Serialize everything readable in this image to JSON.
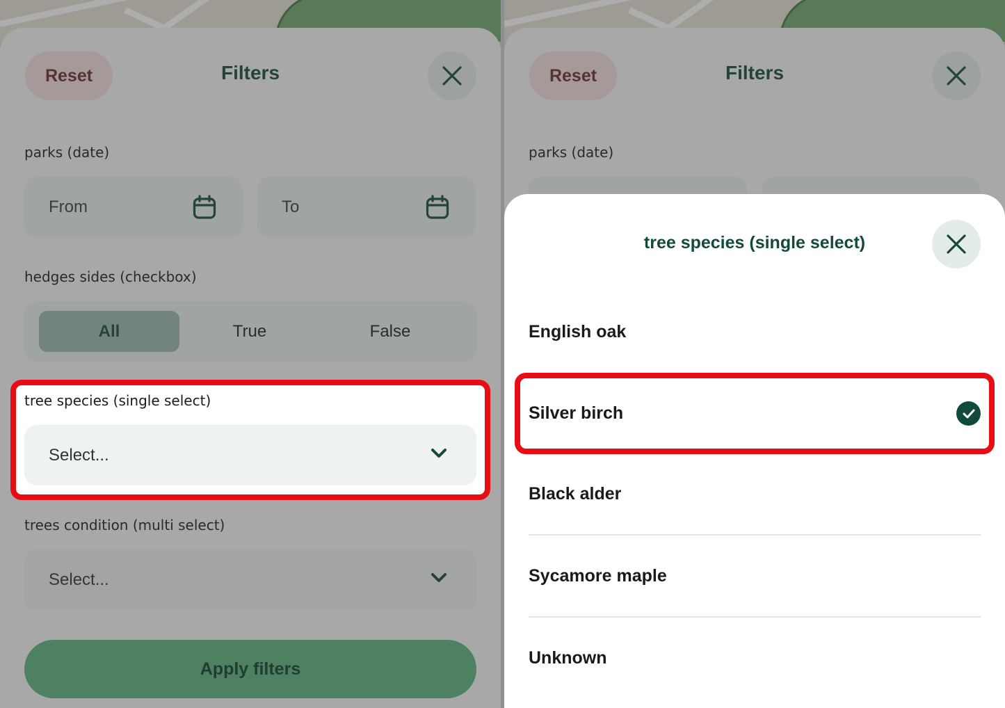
{
  "left": {
    "header": {
      "reset_label": "Reset",
      "title": "Filters"
    },
    "parks_date": {
      "label": "parks (date)",
      "from_placeholder": "From",
      "to_placeholder": "To"
    },
    "hedges": {
      "label": "hedges sides (checkbox)",
      "options": [
        "All",
        "True",
        "False"
      ],
      "selected": "All"
    },
    "tree_species": {
      "label": "tree species (single select)",
      "placeholder": "Select..."
    },
    "trees_condition": {
      "label": "trees condition (multi select)",
      "placeholder": "Select..."
    },
    "apply_label": "Apply filters"
  },
  "right": {
    "header": {
      "reset_label": "Reset",
      "title": "Filters"
    },
    "parks_date_label": "parks (date)",
    "modal": {
      "title": "tree species (single select)",
      "options": [
        "English oak",
        "Silver birch",
        "Black alder",
        "Sycamore maple",
        "Unknown"
      ],
      "selected": "Silver birch"
    }
  },
  "colors": {
    "primary_dark": "#144a3c",
    "apply_green": "#5cb37d",
    "reset_pink": "#f2dcdc",
    "highlight_red": "#e80d15"
  }
}
